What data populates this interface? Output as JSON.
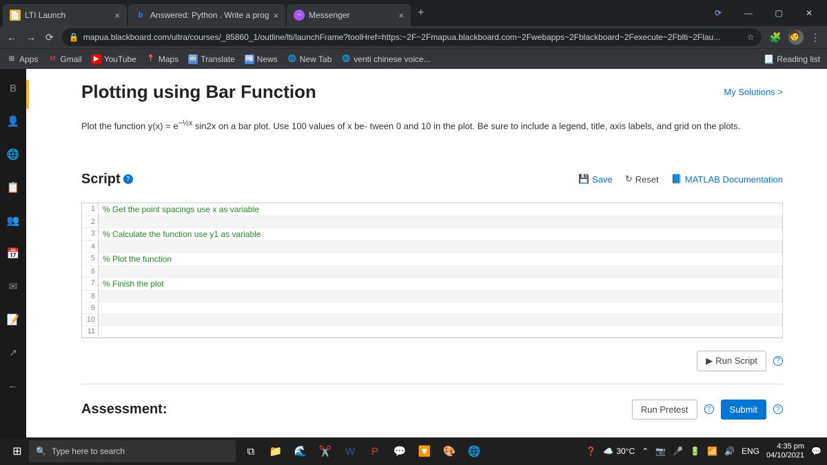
{
  "tabs": [
    {
      "title": "LTI Launch",
      "favicon": "📝"
    },
    {
      "title": "Answered: Python . Write a prog",
      "favicon": "b"
    },
    {
      "title": "Messenger",
      "favicon": "~"
    }
  ],
  "url": "mapua.blackboard.com/ultra/courses/_85860_1/outline/lti/launchFrame?toolHref=https:~2F~2Fmapua.blackboard.com~2Fwebapps~2Fblackboard~2Fexecute~2Fblti~2Flau...",
  "bookmarks": {
    "apps": "Apps",
    "gmail": "Gmail",
    "youtube": "YouTube",
    "maps": "Maps",
    "translate": "Translate",
    "news": "News",
    "newtab": "New Tab",
    "venti": "venti chinese voice...",
    "reading": "Reading list"
  },
  "page": {
    "title": "Plotting using Bar Function",
    "my_solutions": "My Solutions >",
    "problem_pre": "Plot the function  y(x) = e",
    "problem_exp": "−½x",
    "problem_mid": " sin2x on a bar plot. Use 100 values of x be- tween 0 and 10 in the plot. Be sure to include a legend, title, axis labels, and grid on the plots.",
    "script_label": "Script",
    "save": "Save",
    "reset": "Reset",
    "matlab_doc": "MATLAB Documentation",
    "lines": [
      "% Get the point spacings use x as variable",
      "",
      "% Calculate the function use y1 as variable",
      "",
      "% Plot the function",
      "",
      "% Finish the plot",
      "",
      "",
      "",
      ""
    ],
    "run_script": "Run Script",
    "assessment": "Assessment:",
    "run_pretest": "Run Pretest",
    "submit": "Submit"
  },
  "taskbar": {
    "search": "Type here to search",
    "temp": "30°C",
    "lang": "ENG",
    "time": "4:35 pm",
    "date": "04/10/2021"
  }
}
